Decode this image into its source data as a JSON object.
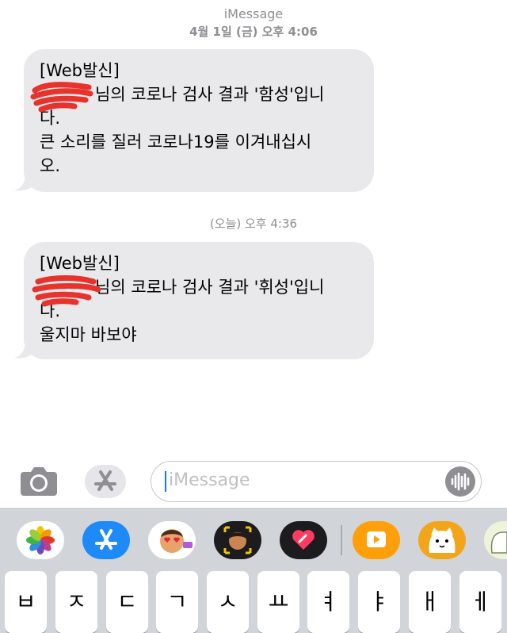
{
  "header": {
    "service_label": "iMessage",
    "timestamp_1": "4월 1일 (금) 오후 4:06",
    "timestamp_2": "(오늘) 오후 4:36"
  },
  "messages": [
    {
      "lines": [
        "[Web발신]",
        "님의 코로나 검사 결과 '함성'입니",
        "다.",
        "큰 소리를 질러 코로나19를 이겨내십시",
        "오."
      ]
    },
    {
      "lines": [
        "[Web발신]",
        "님의 코로나 검사 결과 '휘성'입니",
        "다.",
        "울지마 바보야"
      ]
    }
  ],
  "input": {
    "placeholder": "iMessage"
  },
  "icons": {
    "camera": "camera-icon",
    "apps": "app-store-icon",
    "audio": "waveform-icon",
    "tray": [
      "photos-icon",
      "app-store-icon",
      "memoji-stickers-icon",
      "memoji-icon",
      "digital-touch-icon",
      "video-app-icon",
      "cat-sticker-icon",
      "cat-sticker-2-icon"
    ]
  },
  "keyboard": {
    "keys": [
      "ㅂ",
      "ㅈ",
      "ㄷ",
      "ㄱ",
      "ㅅ",
      "ㅛ",
      "ㅕ",
      "ㅑ",
      "ㅐ",
      "ㅔ"
    ]
  },
  "colors": {
    "bubble_bg": "#e9e9eb",
    "caret": "#1476ff",
    "keyboard_bg": "#d1d4d9"
  }
}
